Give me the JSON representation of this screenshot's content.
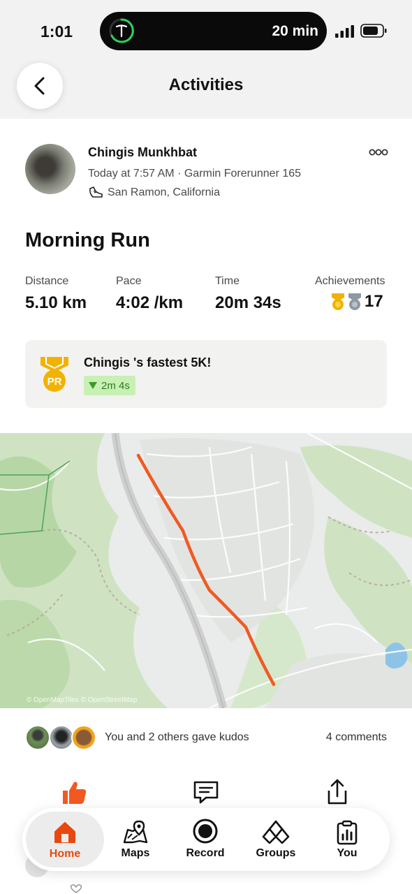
{
  "status_bar": {
    "time": "1:01",
    "island_text": "20 min",
    "accent": "#2fd158"
  },
  "header": {
    "title": "Activities"
  },
  "activity": {
    "athlete_name": "Chingis  Munkhbat",
    "meta": "Today at 7:57 AM · Garmin Forerunner 165",
    "location": "San Ramon, California",
    "title": "Morning Run",
    "stats": [
      {
        "label": "Distance",
        "value": "5.10 km"
      },
      {
        "label": "Pace",
        "value": "4:02 /km"
      },
      {
        "label": "Time",
        "value": "20m 34s"
      },
      {
        "label": "Achievements",
        "value": "17"
      }
    ],
    "pr": {
      "badge_text": "PR",
      "title": "Chingis 's fastest 5K!",
      "delta": "2m 4s"
    },
    "map_attribution": "© OpenMapTiles © OpenStreetMap",
    "route_color": "#f05a22",
    "kudos_text": "You and 2 others gave kudos",
    "comments_text": "4 comments"
  },
  "tabs": [
    {
      "label": "Home",
      "icon": "home-icon",
      "active": true
    },
    {
      "label": "Maps",
      "icon": "map-icon",
      "active": false
    },
    {
      "label": "Record",
      "icon": "record-icon",
      "active": false
    },
    {
      "label": "Groups",
      "icon": "groups-icon",
      "active": false
    },
    {
      "label": "You",
      "icon": "you-icon",
      "active": false
    }
  ],
  "colors": {
    "brand": "#e8480f",
    "pr_gold": "#f2b200",
    "pr_chip_bg": "#c8f0b4",
    "pr_chip_text": "#2f7a1f"
  }
}
